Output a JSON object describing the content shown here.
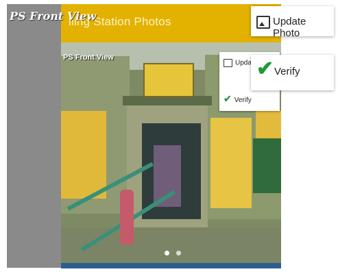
{
  "app": {
    "title": "lling Station Photos",
    "section_heading": "PS Front View"
  },
  "photo": {
    "caption": "PS Front View",
    "carousel_total": 2,
    "carousel_active": 1
  },
  "mini_menu": {
    "update_label": "Upda",
    "verify_label": "Verify"
  },
  "popup_menu": {
    "update_photo_label": "Update Photo",
    "update_photo_icon": "image-icon",
    "verify_label": "Verify",
    "verify_icon": "checkmark-icon"
  },
  "colors": {
    "header": "#e3b100",
    "verify_check": "#1e9a37"
  }
}
